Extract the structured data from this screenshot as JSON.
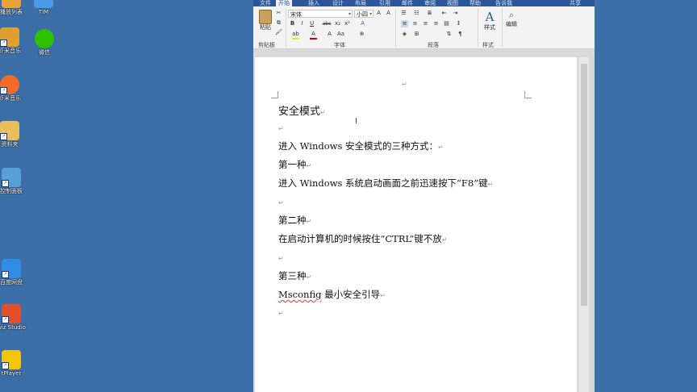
{
  "desktop": {
    "icons": [
      {
        "label": "播放列表",
        "color": "#e8a23a"
      },
      {
        "label": "TIM",
        "color": "#4a9be8"
      },
      {
        "label": "虾米音乐",
        "color": "#e0a030"
      },
      {
        "label": "微信",
        "color": "#2dc100"
      },
      {
        "label": "虾米音乐",
        "color": "#f06a2a"
      },
      {
        "label": "资料夹",
        "color": "#e8c05a"
      },
      {
        "label": "控制面板",
        "color": "#5aa0d8"
      },
      {
        "label": "百度网盘",
        "color": "#2f8de4"
      },
      {
        "label": "wiz Studio",
        "color": "#e0502a"
      },
      {
        "label": "tPlayer",
        "color": "#f2c40c"
      }
    ]
  },
  "word": {
    "tabs": [
      "文件",
      "开始",
      "插入",
      "设计",
      "布局",
      "引用",
      "邮件",
      "审阅",
      "视图",
      "帮助",
      "告诉我",
      "共享"
    ],
    "active_tab": "开始",
    "ribbon": {
      "clipboard": {
        "paste_label": "粘贴",
        "group_label": "剪贴板"
      },
      "font": {
        "font_name": "宋体",
        "font_size": "小四",
        "group_label": "字体",
        "bold": "B",
        "italic": "I",
        "underline": "U",
        "strike": "abc",
        "sub": "x₂",
        "sup": "x²"
      },
      "paragraph": {
        "group_label": "段落"
      },
      "styles": {
        "label": "样式",
        "group_label": "样式"
      },
      "editing": {
        "label": "编辑"
      }
    },
    "document": {
      "top_mark": "↵",
      "title": "安全模式",
      "paragraphs": [
        "进入 Windows 安全模式的三种方式：",
        "第一种",
        "进入 Windows 系统启动画面之前迅速按下“F8”键",
        "第二种",
        "在启动计算机的时候按住“CTRL”键不放",
        "第三种",
        "最小安全引导"
      ],
      "msconfig": "Msconfig",
      "para_mark": "↵"
    }
  },
  "colors": {
    "desktop": "#3c6ea8",
    "title_bar": "#2b579a",
    "ribbon": "#f3f3f3",
    "spell_error": "#d33"
  }
}
